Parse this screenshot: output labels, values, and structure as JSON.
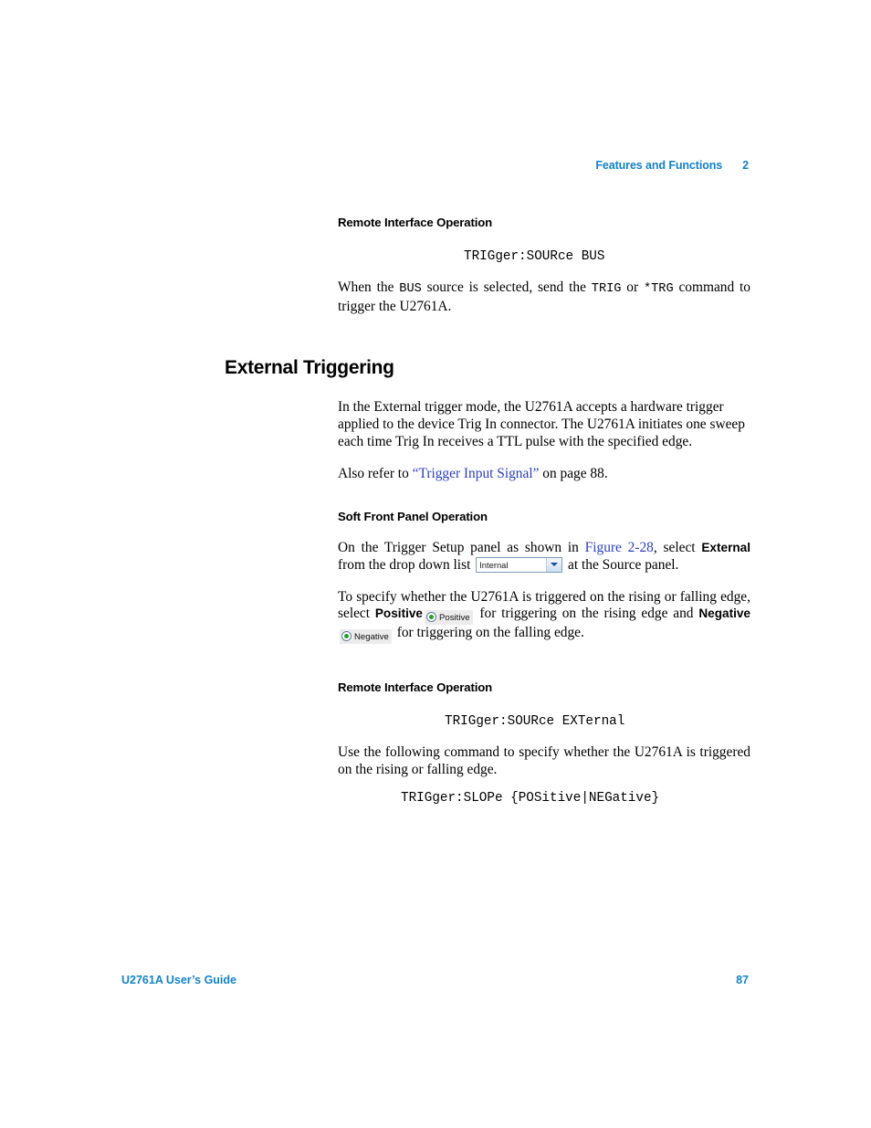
{
  "header": {
    "chapter_title": "Features and Functions",
    "chapter_number": "2",
    "color": "#1482C8"
  },
  "footer": {
    "guide_title": "U2761A User’s Guide",
    "page_number": "87",
    "color": "#1482C8"
  },
  "sections": {
    "remote_interface_1": {
      "heading": "Remote Interface Operation",
      "code": "TRIGger:SOURce BUS",
      "paragraph": {
        "part1": "When the ",
        "mono1": "BUS",
        "part2": " source is selected, send the ",
        "mono2": "TRIG",
        "part3": " or ",
        "mono3": "*TRG",
        "part4": " command to trigger the U2761A."
      }
    },
    "external_triggering": {
      "heading": "External Triggering",
      "paragraph1": "In the External trigger mode, the U2761A accepts a hardware trigger applied to the device Trig In connector. The U2761A initiates one sweep each time Trig In receives a TTL pulse with the specified edge.",
      "refer_line": {
        "part1": "Also refer to ",
        "link": "“Trigger Input Signal”",
        "part2": " on page 88."
      }
    },
    "soft_front_panel": {
      "heading": "Soft Front Panel Operation",
      "paragraph_sfp": {
        "part1": "On the Trigger Setup panel as shown in ",
        "figure_link": "Figure 2-28",
        "part2": ", select ",
        "bold_external": "External",
        "part3": " from the drop down list ",
        "part4": " at the Source panel."
      },
      "source_dropdown": {
        "selected_value": "Internal",
        "chevron_icon": "chevron-down-icon"
      },
      "paragraph_slope": {
        "part1": "To specify whether the U2761A is triggered on the rising or falling edge, select ",
        "bold_positive": "Positive",
        "part2": " for triggering on the rising edge and ",
        "bold_negative": "Negative",
        "part3": " for triggering on the falling edge."
      },
      "radio_positive": {
        "label": "Positive",
        "selected": true,
        "dot_color": "#26A02C"
      },
      "radio_negative": {
        "label": "Negative",
        "selected": true,
        "dot_color": "#26A02C"
      }
    },
    "remote_interface_2": {
      "heading": "Remote Interface Operation",
      "code1": "TRIGger:SOURce EXTernal",
      "paragraph": "Use the following command to specify whether the U2761A is triggered on the rising or falling edge.",
      "code2": "TRIGger:SLOPe {POSitive|NEGative}"
    }
  }
}
